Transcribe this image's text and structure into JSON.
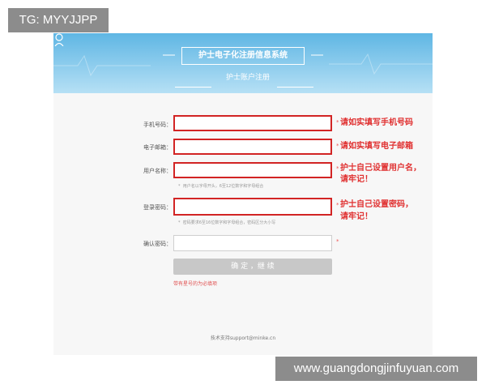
{
  "watermark_top": "TG: MYYJJPP",
  "watermark_bottom": "www.guangdongjinfuyuan.com",
  "header": {
    "title": "护士电子化注册信息系统",
    "subtitle": "护士账户注册"
  },
  "form": {
    "phone_label": "手机号码：",
    "email_label": "电子邮箱：",
    "username_label": "用户名称：",
    "username_hint": "用户名以字母开头，6至12位数字和字母组合",
    "password_label": "登录密码：",
    "password_hint": "密码要求6至16位数字和字母组合，密码区分大小写",
    "confirm_label": "确认密码：",
    "submit_label": "确 定 ，继 续",
    "required_note": "带有星号的为必填项"
  },
  "annotations": {
    "phone_note": "请如实填写手机号码",
    "email_note": "请如实填写电子邮箱",
    "username_note_1": "护士自己设置用户名，",
    "username_note_2": "请牢记！",
    "password_note_1": "护士自己设置密码，",
    "password_note_2": "请牢记！"
  },
  "footer": {
    "support": "技术支持support@minke.cn"
  }
}
